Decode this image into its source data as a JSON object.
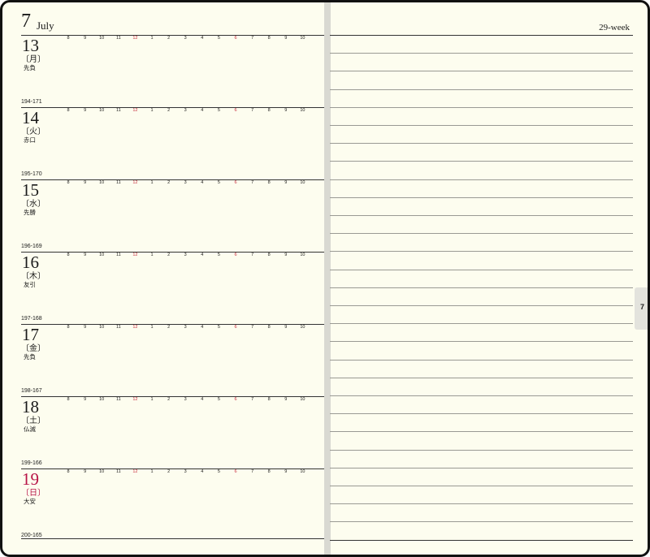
{
  "header": {
    "month_number": "7",
    "month_name": "July",
    "week_label": "29-week"
  },
  "hours": [
    "8",
    "9",
    "10",
    "11",
    "12",
    "1",
    "2",
    "3",
    "4",
    "5",
    "6",
    "7",
    "8",
    "9",
    "10"
  ],
  "days": [
    {
      "date": "13",
      "weekday": "〔月〕",
      "rokuyo": "先負",
      "day_count": "194-171",
      "sunday": false
    },
    {
      "date": "14",
      "weekday": "〔火〕",
      "rokuyo": "赤口",
      "day_count": "195-170",
      "sunday": false
    },
    {
      "date": "15",
      "weekday": "〔水〕",
      "rokuyo": "先勝",
      "day_count": "196-169",
      "sunday": false
    },
    {
      "date": "16",
      "weekday": "〔木〕",
      "rokuyo": "友引",
      "day_count": "197-168",
      "sunday": false
    },
    {
      "date": "17",
      "weekday": "〔金〕",
      "rokuyo": "先負",
      "day_count": "198-167",
      "sunday": false
    },
    {
      "date": "18",
      "weekday": "〔土〕",
      "rokuyo": "仏滅",
      "day_count": "199-166",
      "sunday": false
    },
    {
      "date": "19",
      "weekday": "〔日〕",
      "rokuyo": "大安",
      "day_count": "200-165",
      "sunday": true
    }
  ],
  "month_tab": "7",
  "colors": {
    "paper": "#fdfdef",
    "sunday_red": "#b81447",
    "hour_red": "#c62a3c",
    "gutter": "#d9d9d2"
  }
}
